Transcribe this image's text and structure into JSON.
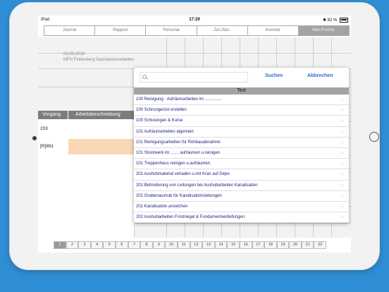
{
  "status": {
    "device": "iPad",
    "time": "17:29",
    "battery": "82 %",
    "bluetooth_icon": "bluetooth-icon",
    "wifi_icon": "wifi-icon"
  },
  "tabs": [
    "Journal",
    "Rapport",
    "Personal",
    "Zul./Abs.",
    "Inventar",
    "Mat./Fremd."
  ],
  "project": {
    "date": "03.03.2016",
    "name": "MFH Finkenberg Dachdeckerarbeiten"
  },
  "columns": {
    "vorgang": "Vorgang",
    "beschreibung": "Arbeitsbeschreibung"
  },
  "rows": [
    {
      "vorgang": "203"
    },
    {
      "vorgang": "[R]891"
    }
  ],
  "popup": {
    "search_value": "",
    "search_button": "Suchen",
    "cancel_button": "Abbrechen",
    "header": "Text",
    "items": [
      "100 Reinigung  - Aufräumarbeiten im ..............",
      "100 Schnurgerüst erstellen",
      "100 Schulungen & Kurse",
      "101 Aufräumarbeiten algemein",
      "101 Reinigungsarbeiten für Rohbauabnahme",
      "101 Stockwerk im ....... aufräumen u.reinigen",
      "101 Treppenhaus reinigen u.aufräumen",
      "201 Aushubmaterial verladen u.mit Kran auf Depo",
      "201 Behinderung von Leitungen bei Aushubarbeiten Kanalisation",
      "201 Grabenaushub für Kanalisationsleitungen",
      "201 Kanalisation anzeichen",
      "202 Aushubarbeiten Frostriegel & Fundamentvertiefungen"
    ]
  },
  "pager": [
    "1",
    "2",
    "3",
    "4",
    "5",
    "6",
    "7",
    "8",
    "9",
    "10",
    "11",
    "12",
    "13",
    "14",
    "15",
    "16",
    "17",
    "18",
    "19",
    "20",
    "21",
    "22"
  ]
}
